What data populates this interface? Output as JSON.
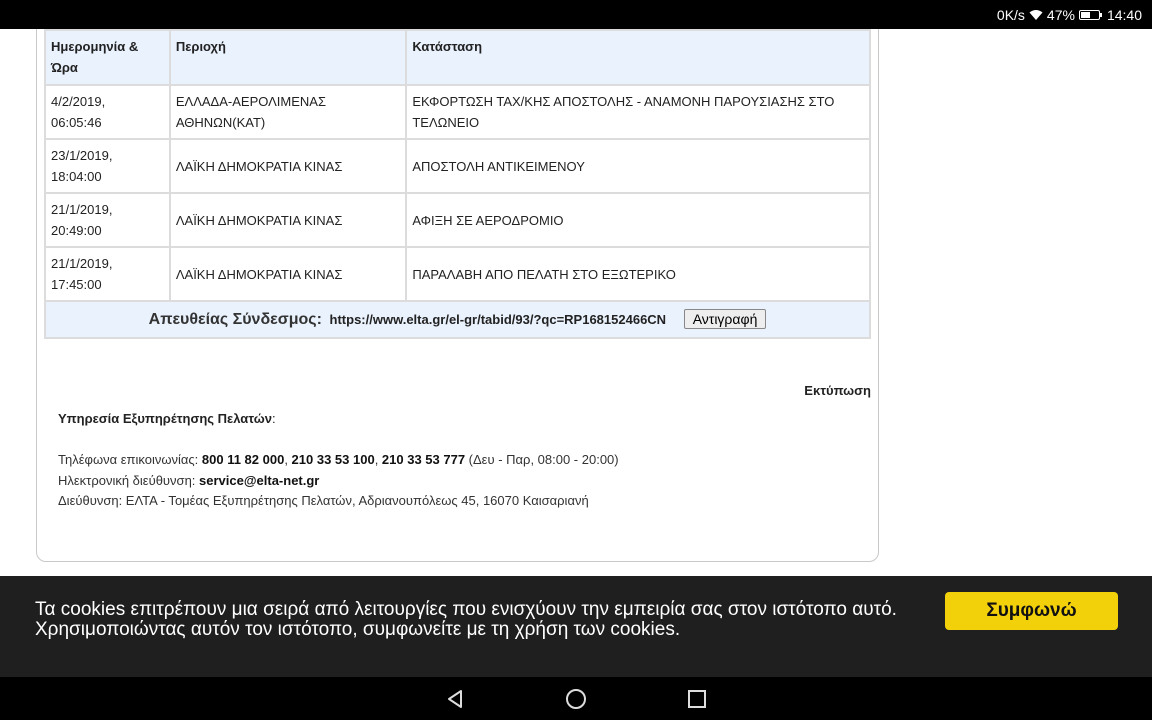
{
  "status": {
    "speed": "0K/s",
    "battery": "47%",
    "time": "14:40"
  },
  "table": {
    "headers": [
      "Ημερομηνία & Ώρα",
      "Περιοχή",
      "Κατάσταση"
    ],
    "rows": [
      {
        "date": "4/2/2019,",
        "time": "06:05:46",
        "area": "ΕΛΛΑΔΑ-ΑΕΡΟΛΙΜΕΝΑΣ ΑΘΗΝΩΝ(ΚΑΤ)",
        "status": "ΕΚΦΟΡΤΩΣΗ ΤΑΧ/ΚΗΣ ΑΠΟΣΤΟΛΗΣ - ΑΝΑΜΟΝΗ ΠΑΡΟΥΣΙΑΣΗΣ ΣΤΟ ΤΕΛΩΝΕΙΟ"
      },
      {
        "date": "23/1/2019,",
        "time": "18:04:00",
        "area": "ΛΑΪΚΗ ΔΗΜΟΚΡΑΤΙΑ ΚΙΝΑΣ",
        "status": "ΑΠΟΣΤΟΛΗ ΑΝΤΙΚΕΙΜΕΝΟΥ"
      },
      {
        "date": "21/1/2019,",
        "time": "20:49:00",
        "area": "ΛΑΪΚΗ ΔΗΜΟΚΡΑΤΙΑ ΚΙΝΑΣ",
        "status": "ΑΦΙΞΗ ΣΕ ΑΕΡΟΔΡΟΜΙΟ"
      },
      {
        "date": "21/1/2019,",
        "time": "17:45:00",
        "area": "ΛΑΪΚΗ ΔΗΜΟΚΡΑΤΙΑ ΚΙΝΑΣ",
        "status": "ΠΑΡΑΛΑΒΗ ΑΠΟ ΠΕΛΑΤΗ ΣΤΟ ΕΞΩΤΕΡΙΚΟ"
      }
    ],
    "direct_link_label": "Απευθείας Σύνδεσμος:",
    "direct_link_url": "https://www.elta.gr/el-gr/tabid/93/?qc=RP168152466CN",
    "copy_button": "Αντιγραφή"
  },
  "print_link": "Εκτύπωση",
  "support": {
    "heading": "Υπηρεσία Εξυπηρέτησης Πελατών",
    "colon": ":",
    "phone_label": "Τηλέφωνα επικοινωνίας: ",
    "phone1": "800 11 82 000",
    "phone2": "210 33 53 100",
    "phone3": "210 33 53 777",
    "hours": " (Δευ - Παρ, 08:00 - 20:00)",
    "email_label": "Ηλεκτρονική διεύθυνση: ",
    "email": "service@elta-net.gr",
    "address": "Διεύθυνση: ΕΛΤΑ - Τομέας Εξυπηρέτησης Πελατών, Αδριανουπόλεως 45, 16070 Καισαριανή"
  },
  "cookie": {
    "line1": "Τα cookies επιτρέπουν μια σειρά από λειτουργίες που ενισχύουν την εμπειρία σας στον ιστότοπο αυτό.",
    "line2": "Χρησιμοποιώντας αυτόν τον ιστότοπο, συμφωνείτε με τη χρήση των cookies.",
    "accept": "Συμφωνώ"
  },
  "colors": {
    "accent": "#f2d10b",
    "header_bg": "#eaf2fd",
    "cookie_bg": "#1f1f1f"
  }
}
